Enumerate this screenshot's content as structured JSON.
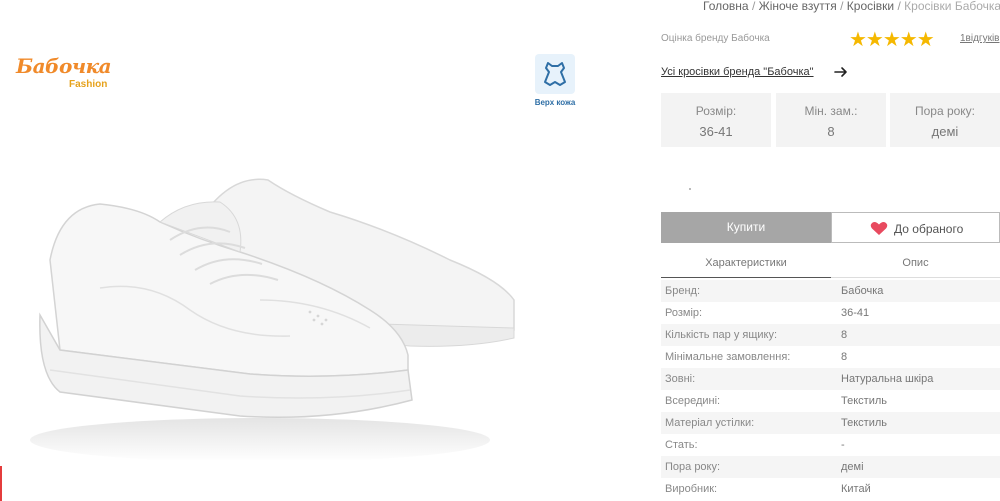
{
  "brand": {
    "logo_text": "Бабочка",
    "logo_sub": "Fashion"
  },
  "leather_badge": {
    "label": "Верх кожа",
    "icon": "leather-hide-icon"
  },
  "breadcrumb": {
    "items": [
      "Головна",
      "Жіноче взуття",
      "Кросівки",
      "Кросівки Бабочка"
    ],
    "separator": "/"
  },
  "rating": {
    "label": "Оцінка бренду Бабочка",
    "stars": "★★★★★",
    "reviews_link": "1відгуків"
  },
  "all_link": "Усі кросівки бренда \"Бабочка\"",
  "specs": [
    {
      "label": "Розмір:",
      "value": "36-41"
    },
    {
      "label": "Мін. зам.:",
      "value": "8"
    },
    {
      "label": "Пора року:",
      "value": "демі"
    }
  ],
  "actions": {
    "buy": "Купити",
    "favorite": "До обраного"
  },
  "tabs": [
    "Характеристики",
    "Опис"
  ],
  "characteristics": [
    {
      "key": "Бренд:",
      "value": "Бабочка"
    },
    {
      "key": "Розмір:",
      "value": "36-41"
    },
    {
      "key": "Кількість пар у ящику:",
      "value": "8"
    },
    {
      "key": "Мінімальне замовлення:",
      "value": "8"
    },
    {
      "key": "Зовні:",
      "value": "Натуральна шкіра"
    },
    {
      "key": "Всередині:",
      "value": "Текстиль"
    },
    {
      "key": "Матеріал устілки:",
      "value": "Текстиль"
    },
    {
      "key": "Стать:",
      "value": "-"
    },
    {
      "key": "Пора року:",
      "value": "демі"
    },
    {
      "key": "Виробник:",
      "value": "Китай"
    }
  ],
  "colors": {
    "star": "#f5b800",
    "heart": "#e84a5f",
    "buy_bg": "#a6a6a6",
    "logo": "#f08a2a"
  }
}
